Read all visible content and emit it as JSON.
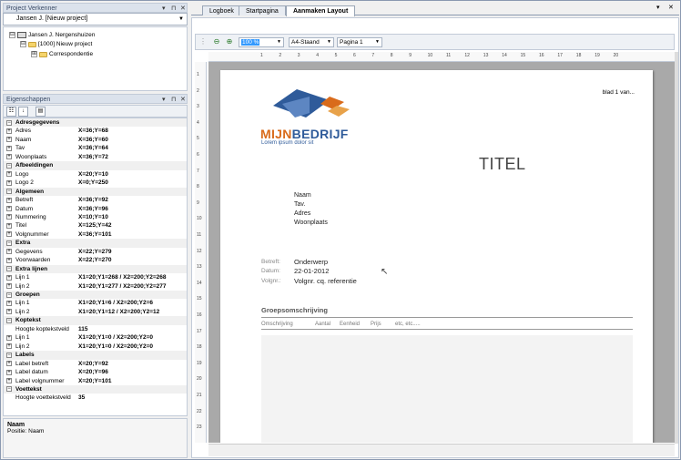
{
  "explorer": {
    "title": "Project Verkenner",
    "controls": [
      "▾",
      "⊓",
      "✕"
    ],
    "combo_value": "Jansen J. [Nieuw project]",
    "tree": [
      {
        "label": "Jansen J. Nergenshuizen",
        "level": 0,
        "icon": "computer-icon",
        "expander": "⊟"
      },
      {
        "label": "[1000] Nieuw project",
        "level": 1,
        "icon": "folder-open-icon",
        "expander": "⊟"
      },
      {
        "label": "Correspondentie",
        "level": 2,
        "icon": "folder-icon",
        "expander": "⊞"
      }
    ]
  },
  "properties": {
    "title": "Eigenschappen",
    "controls": [
      "▾",
      "⊓",
      "✕"
    ],
    "rows": [
      {
        "type": "cat",
        "name": "Adresgegevens"
      },
      {
        "type": "prop",
        "name": "Adres",
        "value": "X=36;Y=68"
      },
      {
        "type": "prop",
        "name": "Naam",
        "value": "X=36;Y=60"
      },
      {
        "type": "prop",
        "name": "Tav",
        "value": "X=36;Y=64"
      },
      {
        "type": "prop",
        "name": "Woonplaats",
        "value": "X=36;Y=72"
      },
      {
        "type": "cat",
        "name": "Afbeeldingen"
      },
      {
        "type": "prop",
        "name": "Logo",
        "value": "X=20;Y=10"
      },
      {
        "type": "prop",
        "name": "Logo 2",
        "value": "X=0;Y=250"
      },
      {
        "type": "cat",
        "name": "Algemeen"
      },
      {
        "type": "prop",
        "name": "Betreft",
        "value": "X=36;Y=92"
      },
      {
        "type": "prop",
        "name": "Datum",
        "value": "X=36;Y=96"
      },
      {
        "type": "prop",
        "name": "Nummering",
        "value": "X=10;Y=10"
      },
      {
        "type": "prop",
        "name": "Titel",
        "value": "X=125;Y=42"
      },
      {
        "type": "prop",
        "name": "Volgnummer",
        "value": "X=36;Y=101"
      },
      {
        "type": "cat",
        "name": "Extra"
      },
      {
        "type": "prop",
        "name": "Gegevens",
        "value": "X=22;Y=279"
      },
      {
        "type": "prop",
        "name": "Voorwaarden",
        "value": "X=22;Y=270"
      },
      {
        "type": "cat",
        "name": "Extra lijnen"
      },
      {
        "type": "prop",
        "name": "Lijn 1",
        "value": "X1=20;Y1=268 / X2=200;Y2=268"
      },
      {
        "type": "prop",
        "name": "Lijn 2",
        "value": "X1=20;Y1=277 / X2=200;Y2=277"
      },
      {
        "type": "cat",
        "name": "Groepen"
      },
      {
        "type": "prop",
        "name": "Lijn 1",
        "value": "X1=20;Y1=6 / X2=200;Y2=6"
      },
      {
        "type": "prop",
        "name": "Lijn 2",
        "value": "X1=20;Y1=12 / X2=200;Y2=12"
      },
      {
        "type": "cat",
        "name": "Koptekst"
      },
      {
        "type": "plain",
        "name": "Hoogte koptekstveld",
        "value": "115"
      },
      {
        "type": "prop",
        "name": "Lijn 1",
        "value": "X1=20;Y1=0 / X2=200;Y2=0"
      },
      {
        "type": "prop",
        "name": "Lijn 2",
        "value": "X1=20;Y1=0 / X2=200;Y2=0"
      },
      {
        "type": "cat",
        "name": "Labels"
      },
      {
        "type": "prop",
        "name": "Label betreft",
        "value": "X=20;Y=92"
      },
      {
        "type": "prop",
        "name": "Label datum",
        "value": "X=20;Y=96"
      },
      {
        "type": "prop",
        "name": "Label volgnummer",
        "value": "X=20;Y=101"
      },
      {
        "type": "cat",
        "name": "Voettekst"
      },
      {
        "type": "plain",
        "name": "Hoogte voettekstveld",
        "value": "35"
      }
    ],
    "description": {
      "title": "Naam",
      "text": "Positie: Naam"
    }
  },
  "tabs": [
    {
      "label": "Logboek",
      "active": false
    },
    {
      "label": "Startpagina",
      "active": false
    },
    {
      "label": "Aanmaken Layout",
      "active": true
    }
  ],
  "tab_controls": [
    "▾",
    "✕"
  ],
  "viewer": {
    "zoom": "100 %",
    "paper": "A4-Staand",
    "page": "Pagina 1"
  },
  "ruler": {
    "h_labels": [
      "1",
      "2",
      "3",
      "4",
      "5",
      "6",
      "7",
      "8",
      "9",
      "10",
      "11",
      "12",
      "13",
      "14",
      "15",
      "16",
      "17",
      "18",
      "19",
      "20"
    ],
    "v_labels": [
      "1",
      "2",
      "3",
      "4",
      "5",
      "6",
      "7",
      "8",
      "9",
      "10",
      "11",
      "12",
      "13",
      "14",
      "15",
      "16",
      "17",
      "18",
      "19",
      "20",
      "21",
      "22",
      "23"
    ]
  },
  "document": {
    "blad": "blad 1 van...",
    "logo_part1": "MIJN",
    "logo_part2": "BEDRIJF",
    "tagline": "Lorem ipsum dolor sit",
    "title": "TITEL",
    "address": [
      "Naam",
      "Tav.",
      "Adres",
      "Woonplaats"
    ],
    "fields": [
      {
        "label": "Betreft:",
        "value": "Onderwerp"
      },
      {
        "label": "Datum:",
        "value": "22-01-2012"
      },
      {
        "label": "Volgnr.:",
        "value": "Volgnr. cq. referentie"
      }
    ],
    "group_title": "Groepsomschrijving",
    "columns": [
      "Omschrijving",
      "Aantal",
      "Eenheid",
      "Prijs",
      "etc, etc....."
    ]
  },
  "colors": {
    "accent": "#2f5b9a",
    "logo_orange": "#d96b1b",
    "panel_header": "#dbe2ec"
  }
}
